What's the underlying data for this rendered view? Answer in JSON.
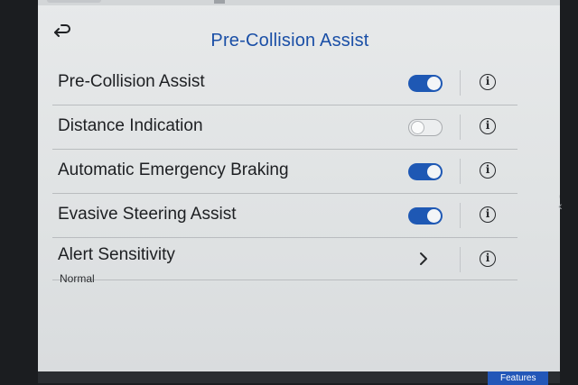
{
  "header": {
    "title": "Pre-Collision Assist",
    "back_icon": "back-arrow-icon"
  },
  "settings": [
    {
      "label": "Pre-Collision Assist",
      "control": "toggle",
      "enabled": true
    },
    {
      "label": "Distance Indication",
      "control": "toggle",
      "enabled": false
    },
    {
      "label": "Automatic Emergency Braking",
      "control": "toggle",
      "enabled": true
    },
    {
      "label": "Evasive Steering Assist",
      "control": "toggle",
      "enabled": true
    },
    {
      "label": "Alert Sensitivity",
      "value": "Normal",
      "control": "chevron"
    }
  ],
  "info_icon_glyph": "i",
  "bottom_nav": {
    "features_label": "Features"
  },
  "colors": {
    "accent": "#1e58b4",
    "title": "#1a4fa6",
    "background": "#e3e6e7"
  }
}
